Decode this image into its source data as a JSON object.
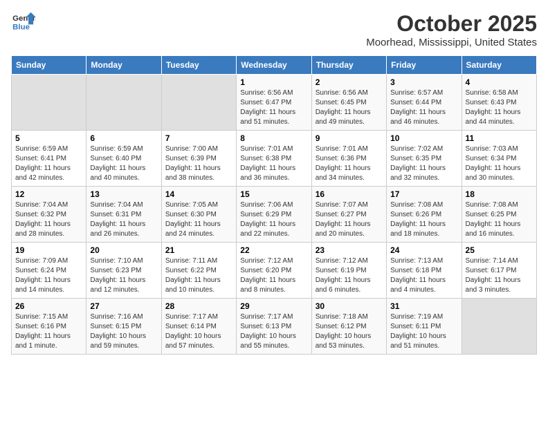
{
  "logo": {
    "line1": "General",
    "line2": "Blue"
  },
  "title": "October 2025",
  "location": "Moorhead, Mississippi, United States",
  "days_of_week": [
    "Sunday",
    "Monday",
    "Tuesday",
    "Wednesday",
    "Thursday",
    "Friday",
    "Saturday"
  ],
  "weeks": [
    [
      {
        "day": "",
        "empty": true
      },
      {
        "day": "",
        "empty": true
      },
      {
        "day": "",
        "empty": true
      },
      {
        "day": "1",
        "sunrise": "6:56 AM",
        "sunset": "6:47 PM",
        "daylight": "11 hours and 51 minutes."
      },
      {
        "day": "2",
        "sunrise": "6:56 AM",
        "sunset": "6:45 PM",
        "daylight": "11 hours and 49 minutes."
      },
      {
        "day": "3",
        "sunrise": "6:57 AM",
        "sunset": "6:44 PM",
        "daylight": "11 hours and 46 minutes."
      },
      {
        "day": "4",
        "sunrise": "6:58 AM",
        "sunset": "6:43 PM",
        "daylight": "11 hours and 44 minutes."
      }
    ],
    [
      {
        "day": "5",
        "sunrise": "6:59 AM",
        "sunset": "6:41 PM",
        "daylight": "11 hours and 42 minutes."
      },
      {
        "day": "6",
        "sunrise": "6:59 AM",
        "sunset": "6:40 PM",
        "daylight": "11 hours and 40 minutes."
      },
      {
        "day": "7",
        "sunrise": "7:00 AM",
        "sunset": "6:39 PM",
        "daylight": "11 hours and 38 minutes."
      },
      {
        "day": "8",
        "sunrise": "7:01 AM",
        "sunset": "6:38 PM",
        "daylight": "11 hours and 36 minutes."
      },
      {
        "day": "9",
        "sunrise": "7:01 AM",
        "sunset": "6:36 PM",
        "daylight": "11 hours and 34 minutes."
      },
      {
        "day": "10",
        "sunrise": "7:02 AM",
        "sunset": "6:35 PM",
        "daylight": "11 hours and 32 minutes."
      },
      {
        "day": "11",
        "sunrise": "7:03 AM",
        "sunset": "6:34 PM",
        "daylight": "11 hours and 30 minutes."
      }
    ],
    [
      {
        "day": "12",
        "sunrise": "7:04 AM",
        "sunset": "6:32 PM",
        "daylight": "11 hours and 28 minutes."
      },
      {
        "day": "13",
        "sunrise": "7:04 AM",
        "sunset": "6:31 PM",
        "daylight": "11 hours and 26 minutes."
      },
      {
        "day": "14",
        "sunrise": "7:05 AM",
        "sunset": "6:30 PM",
        "daylight": "11 hours and 24 minutes."
      },
      {
        "day": "15",
        "sunrise": "7:06 AM",
        "sunset": "6:29 PM",
        "daylight": "11 hours and 22 minutes."
      },
      {
        "day": "16",
        "sunrise": "7:07 AM",
        "sunset": "6:27 PM",
        "daylight": "11 hours and 20 minutes."
      },
      {
        "day": "17",
        "sunrise": "7:08 AM",
        "sunset": "6:26 PM",
        "daylight": "11 hours and 18 minutes."
      },
      {
        "day": "18",
        "sunrise": "7:08 AM",
        "sunset": "6:25 PM",
        "daylight": "11 hours and 16 minutes."
      }
    ],
    [
      {
        "day": "19",
        "sunrise": "7:09 AM",
        "sunset": "6:24 PM",
        "daylight": "11 hours and 14 minutes."
      },
      {
        "day": "20",
        "sunrise": "7:10 AM",
        "sunset": "6:23 PM",
        "daylight": "11 hours and 12 minutes."
      },
      {
        "day": "21",
        "sunrise": "7:11 AM",
        "sunset": "6:22 PM",
        "daylight": "11 hours and 10 minutes."
      },
      {
        "day": "22",
        "sunrise": "7:12 AM",
        "sunset": "6:20 PM",
        "daylight": "11 hours and 8 minutes."
      },
      {
        "day": "23",
        "sunrise": "7:12 AM",
        "sunset": "6:19 PM",
        "daylight": "11 hours and 6 minutes."
      },
      {
        "day": "24",
        "sunrise": "7:13 AM",
        "sunset": "6:18 PM",
        "daylight": "11 hours and 4 minutes."
      },
      {
        "day": "25",
        "sunrise": "7:14 AM",
        "sunset": "6:17 PM",
        "daylight": "11 hours and 3 minutes."
      }
    ],
    [
      {
        "day": "26",
        "sunrise": "7:15 AM",
        "sunset": "6:16 PM",
        "daylight": "11 hours and 1 minute."
      },
      {
        "day": "27",
        "sunrise": "7:16 AM",
        "sunset": "6:15 PM",
        "daylight": "10 hours and 59 minutes."
      },
      {
        "day": "28",
        "sunrise": "7:17 AM",
        "sunset": "6:14 PM",
        "daylight": "10 hours and 57 minutes."
      },
      {
        "day": "29",
        "sunrise": "7:17 AM",
        "sunset": "6:13 PM",
        "daylight": "10 hours and 55 minutes."
      },
      {
        "day": "30",
        "sunrise": "7:18 AM",
        "sunset": "6:12 PM",
        "daylight": "10 hours and 53 minutes."
      },
      {
        "day": "31",
        "sunrise": "7:19 AM",
        "sunset": "6:11 PM",
        "daylight": "10 hours and 51 minutes."
      },
      {
        "day": "",
        "empty": true
      }
    ]
  ],
  "labels": {
    "sunrise": "Sunrise:",
    "sunset": "Sunset:",
    "daylight": "Daylight:"
  }
}
